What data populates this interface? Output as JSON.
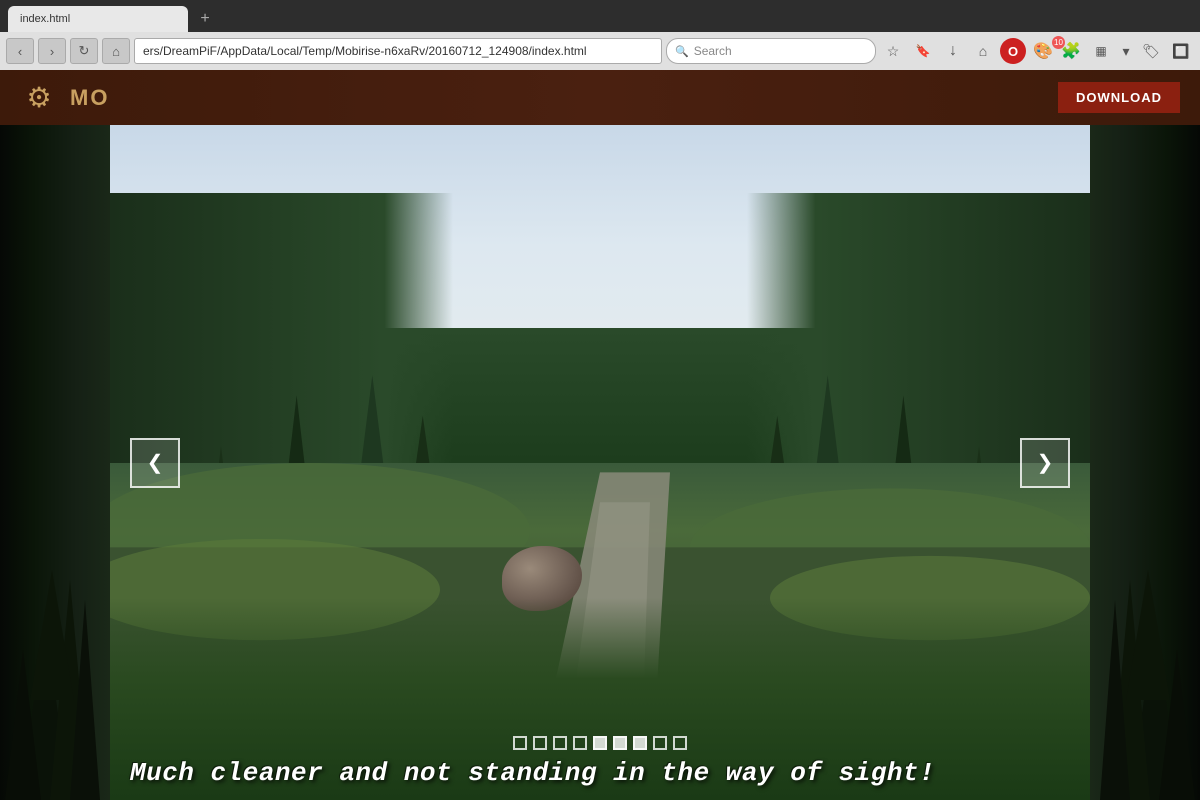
{
  "browser": {
    "address_bar": {
      "url": "ers/DreamPiF/AppData/Local/Temp/Mobirise-n6xaRv/20160712_124908/index.html",
      "label": "address-bar"
    },
    "search_placeholder": "Search",
    "reload_icon": "↻",
    "nav_back": "‹",
    "nav_forward": "›",
    "tab_label": "index.html"
  },
  "toolbar_icons": {
    "star": "☆",
    "bookmark": "🔖",
    "download_arrow": "↓",
    "home": "⌂",
    "opera_icon": "O",
    "extensions_icon": "◉",
    "menu_icon": "≡",
    "arrow_dropdown": "▾",
    "notification_count": "10",
    "add_icon": "+"
  },
  "app": {
    "name": "MO",
    "gear_symbol": "⚙",
    "download_label": "DOWNLOAD"
  },
  "slider": {
    "caption": "Much cleaner and not standing in the way of sight!",
    "prev_label": "❮",
    "next_label": "❯",
    "total_slides": 9,
    "active_slide": 5,
    "indicators": [
      0,
      1,
      2,
      3,
      4,
      5,
      6,
      7,
      8
    ]
  },
  "colors": {
    "app_header_bg": "#4a2010",
    "app_accent": "#c8a060",
    "download_btn": "#8b2010",
    "slider_bg": "#2a3a2a",
    "caption_color": "#ffffff",
    "browser_toolbar": "#e0e0e0",
    "indicator_border": "rgba(255,255,255,0.8)"
  }
}
